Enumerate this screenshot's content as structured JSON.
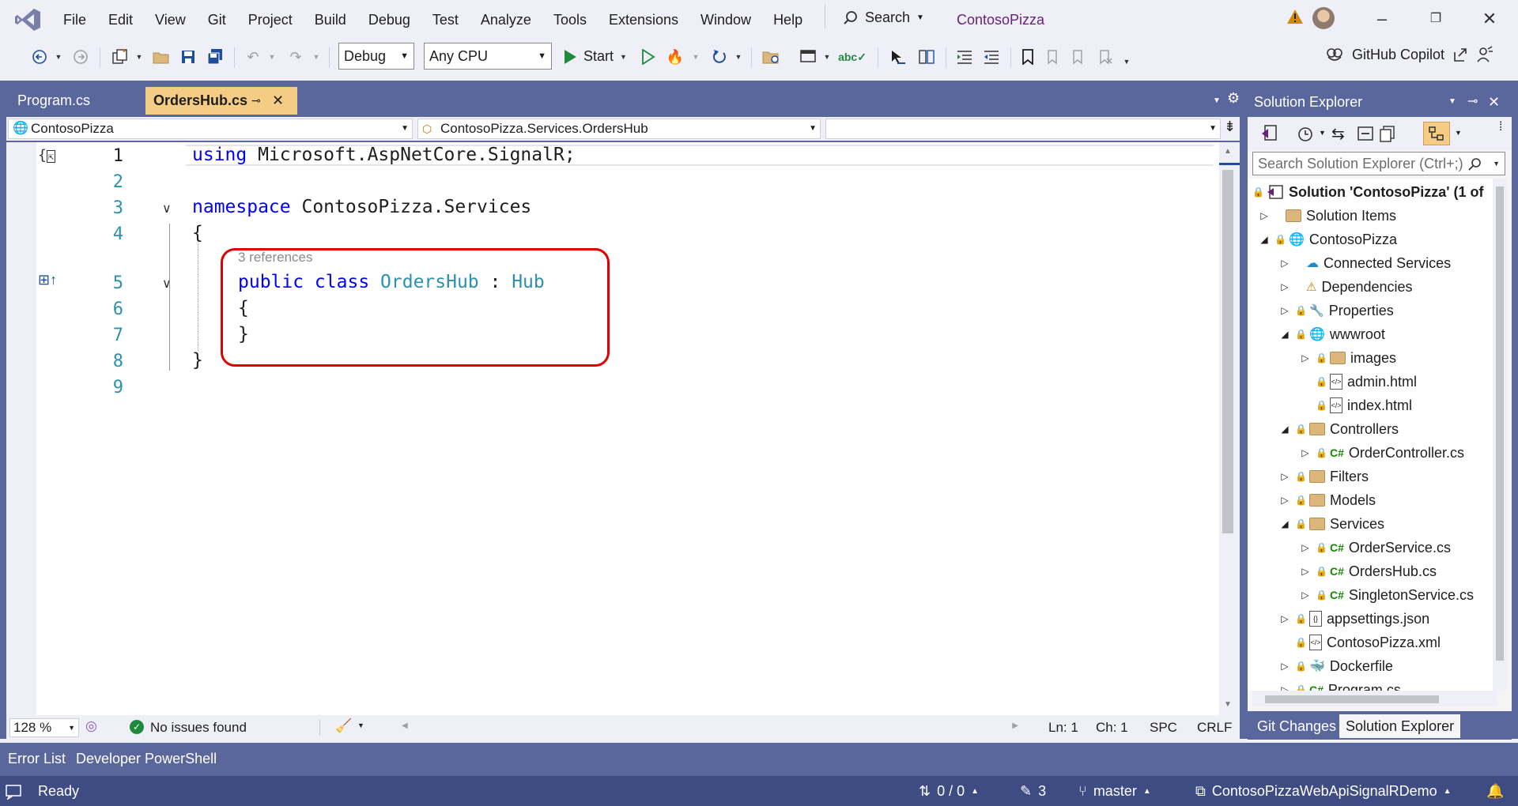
{
  "menubar": {
    "items": [
      "File",
      "Edit",
      "View",
      "Git",
      "Project",
      "Build",
      "Debug",
      "Test",
      "Analyze",
      "Tools",
      "Extensions",
      "Window",
      "Help"
    ],
    "search_label": "Search",
    "app_title": "ContosoPizza"
  },
  "toolbar": {
    "configuration": "Debug",
    "platform": "Any CPU",
    "start_label": "Start",
    "copilot_label": "GitHub Copilot"
  },
  "tabs": [
    {
      "label": "Program.cs",
      "active": false
    },
    {
      "label": "OrdersHub.cs",
      "active": true
    }
  ],
  "nav": {
    "project": "ContosoPizza",
    "type": "ContosoPizza.Services.OrdersHub",
    "member": ""
  },
  "code": {
    "line_numbers": [
      "1",
      "2",
      "3",
      "4",
      "5",
      "6",
      "7",
      "8",
      "9"
    ],
    "line1_kw": "using",
    "line1_rest": " Microsoft.AspNetCore.SignalR;",
    "line3_kw": "namespace",
    "line3_rest": " ContosoPizza.Services",
    "line4": "{",
    "references": "3 references",
    "line5_kw": "public class",
    "line5_name": "OrdersHub",
    "line5_colon": " : ",
    "line5_base": "Hub",
    "line6": "{",
    "line7": "}",
    "line8": "}"
  },
  "editor_status": {
    "zoom": "128 %",
    "issues": "No issues found",
    "line": "Ln: 1",
    "column": "Ch: 1",
    "whitespace": "SPC",
    "line_ending": "CRLF"
  },
  "solution_explorer": {
    "title": "Solution Explorer",
    "search_placeholder": "Search Solution Explorer (Ctrl+;)",
    "tree": [
      {
        "label": "Solution 'ContosoPizza' (1 of",
        "bold": true
      },
      {
        "label": "Solution Items"
      },
      {
        "label": "ContosoPizza"
      },
      {
        "label": "Connected Services"
      },
      {
        "label": "Dependencies"
      },
      {
        "label": "Properties"
      },
      {
        "label": "wwwroot"
      },
      {
        "label": "images"
      },
      {
        "label": "admin.html"
      },
      {
        "label": "index.html"
      },
      {
        "label": "Controllers"
      },
      {
        "label": "OrderController.cs"
      },
      {
        "label": "Filters"
      },
      {
        "label": "Models"
      },
      {
        "label": "Services"
      },
      {
        "label": "OrderService.cs"
      },
      {
        "label": "OrdersHub.cs"
      },
      {
        "label": "SingletonService.cs"
      },
      {
        "label": "appsettings.json"
      },
      {
        "label": "ContosoPizza.xml"
      },
      {
        "label": "Dockerfile"
      },
      {
        "label": "Program.cs"
      }
    ],
    "tabs": [
      "Git Changes",
      "Solution Explorer"
    ]
  },
  "bottom_tabs": [
    "Error List",
    "Developer PowerShell"
  ],
  "statusbar": {
    "ready": "Ready",
    "sync": "0 / 0",
    "edits": "3",
    "branch": "master",
    "repo": "ContosoPizzaWebApiSignalRDemo"
  },
  "colors": {
    "accent": "#5A679D",
    "active_tab": "#F5CC84",
    "highlight_box": "#E00000",
    "keyword": "#0000FF",
    "type": "#2B91AF"
  }
}
